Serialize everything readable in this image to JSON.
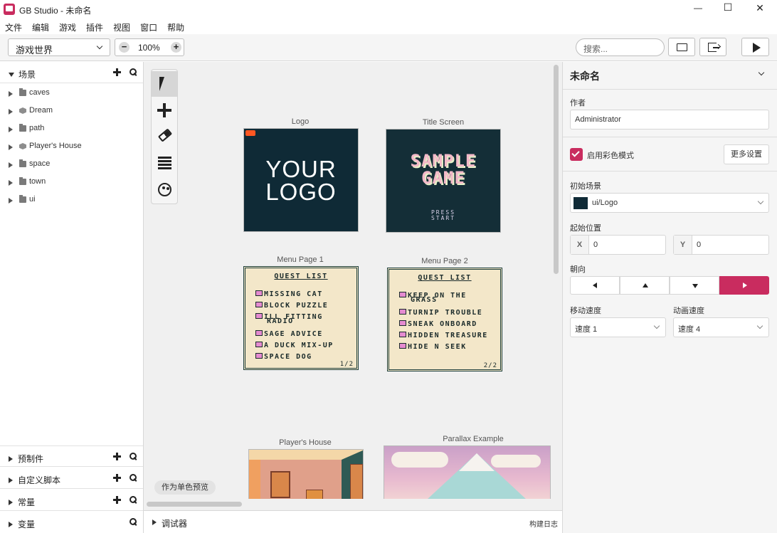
{
  "window": {
    "title": "GB Studio - 未命名",
    "minimize": "—",
    "maximize": "☐",
    "close": "✕"
  },
  "menu": [
    "文件",
    "编辑",
    "游戏",
    "插件",
    "视图",
    "窗口",
    "帮助"
  ],
  "toolbar": {
    "view_select": "游戏世界",
    "zoom": "100%",
    "search_placeholder": "搜索..."
  },
  "sidebar": {
    "scenes_title": "场景",
    "items": [
      {
        "label": "caves",
        "icon": "folder-icon"
      },
      {
        "label": "Dream",
        "icon": "cube-icon"
      },
      {
        "label": "path",
        "icon": "folder-icon"
      },
      {
        "label": "Player's House",
        "icon": "cube-icon"
      },
      {
        "label": "space",
        "icon": "folder-icon"
      },
      {
        "label": "town",
        "icon": "folder-icon"
      },
      {
        "label": "ui",
        "icon": "folder-icon"
      }
    ],
    "sections": [
      "预制件",
      "自定义脚本",
      "常量",
      "变量"
    ]
  },
  "canvas": {
    "scenes": {
      "logo": {
        "name": "Logo",
        "line1": "YOUR",
        "line2": "LOGO"
      },
      "title": {
        "name": "Title Screen",
        "line1": "SAMPLE",
        "line2": "GAME",
        "press": "PRESS",
        "start": "START"
      },
      "menu1": {
        "name": "Menu Page 1",
        "heading": "QUEST LIST",
        "items": [
          "MISSING CAT",
          "BLOCK PUZZLE",
          "ILL FITTING",
          "RADIO",
          "SAGE ADVICE",
          "A DUCK MIX-UP",
          "SPACE DOG"
        ],
        "page": "1/2"
      },
      "menu2": {
        "name": "Menu Page 2",
        "heading": "QUEST LIST",
        "items": [
          "KEEP ON THE",
          "GRASS",
          "TURNIP TROUBLE",
          "SNEAK ONBOARD",
          "HIDDEN TREASURE",
          "HIDE N SEEK"
        ],
        "page": "2/2"
      },
      "house": {
        "name": "Player's House"
      },
      "parallax": {
        "name": "Parallax Example"
      }
    },
    "mono_preview": "作为单色预览"
  },
  "bottom": {
    "debugger": "调试器",
    "build_log": "构建日志"
  },
  "properties": {
    "title": "未命名",
    "author_label": "作者",
    "author": "Administrator",
    "color_mode": "启用彩色模式",
    "more_settings": "更多设置",
    "start_scene_label": "初始场景",
    "start_scene": "ui/Logo",
    "start_pos_label": "起始位置",
    "x_label": "X",
    "x_value": "0",
    "y_label": "Y",
    "y_value": "0",
    "direction_label": "朝向",
    "move_speed_label": "移动速度",
    "move_speed": "速度 1",
    "anim_speed_label": "动画速度",
    "anim_speed": "速度 4"
  },
  "colors": {
    "accent": "#c92c5f",
    "logo_bg": "#0f2a36",
    "menu_bg": "#f3e7c9"
  }
}
